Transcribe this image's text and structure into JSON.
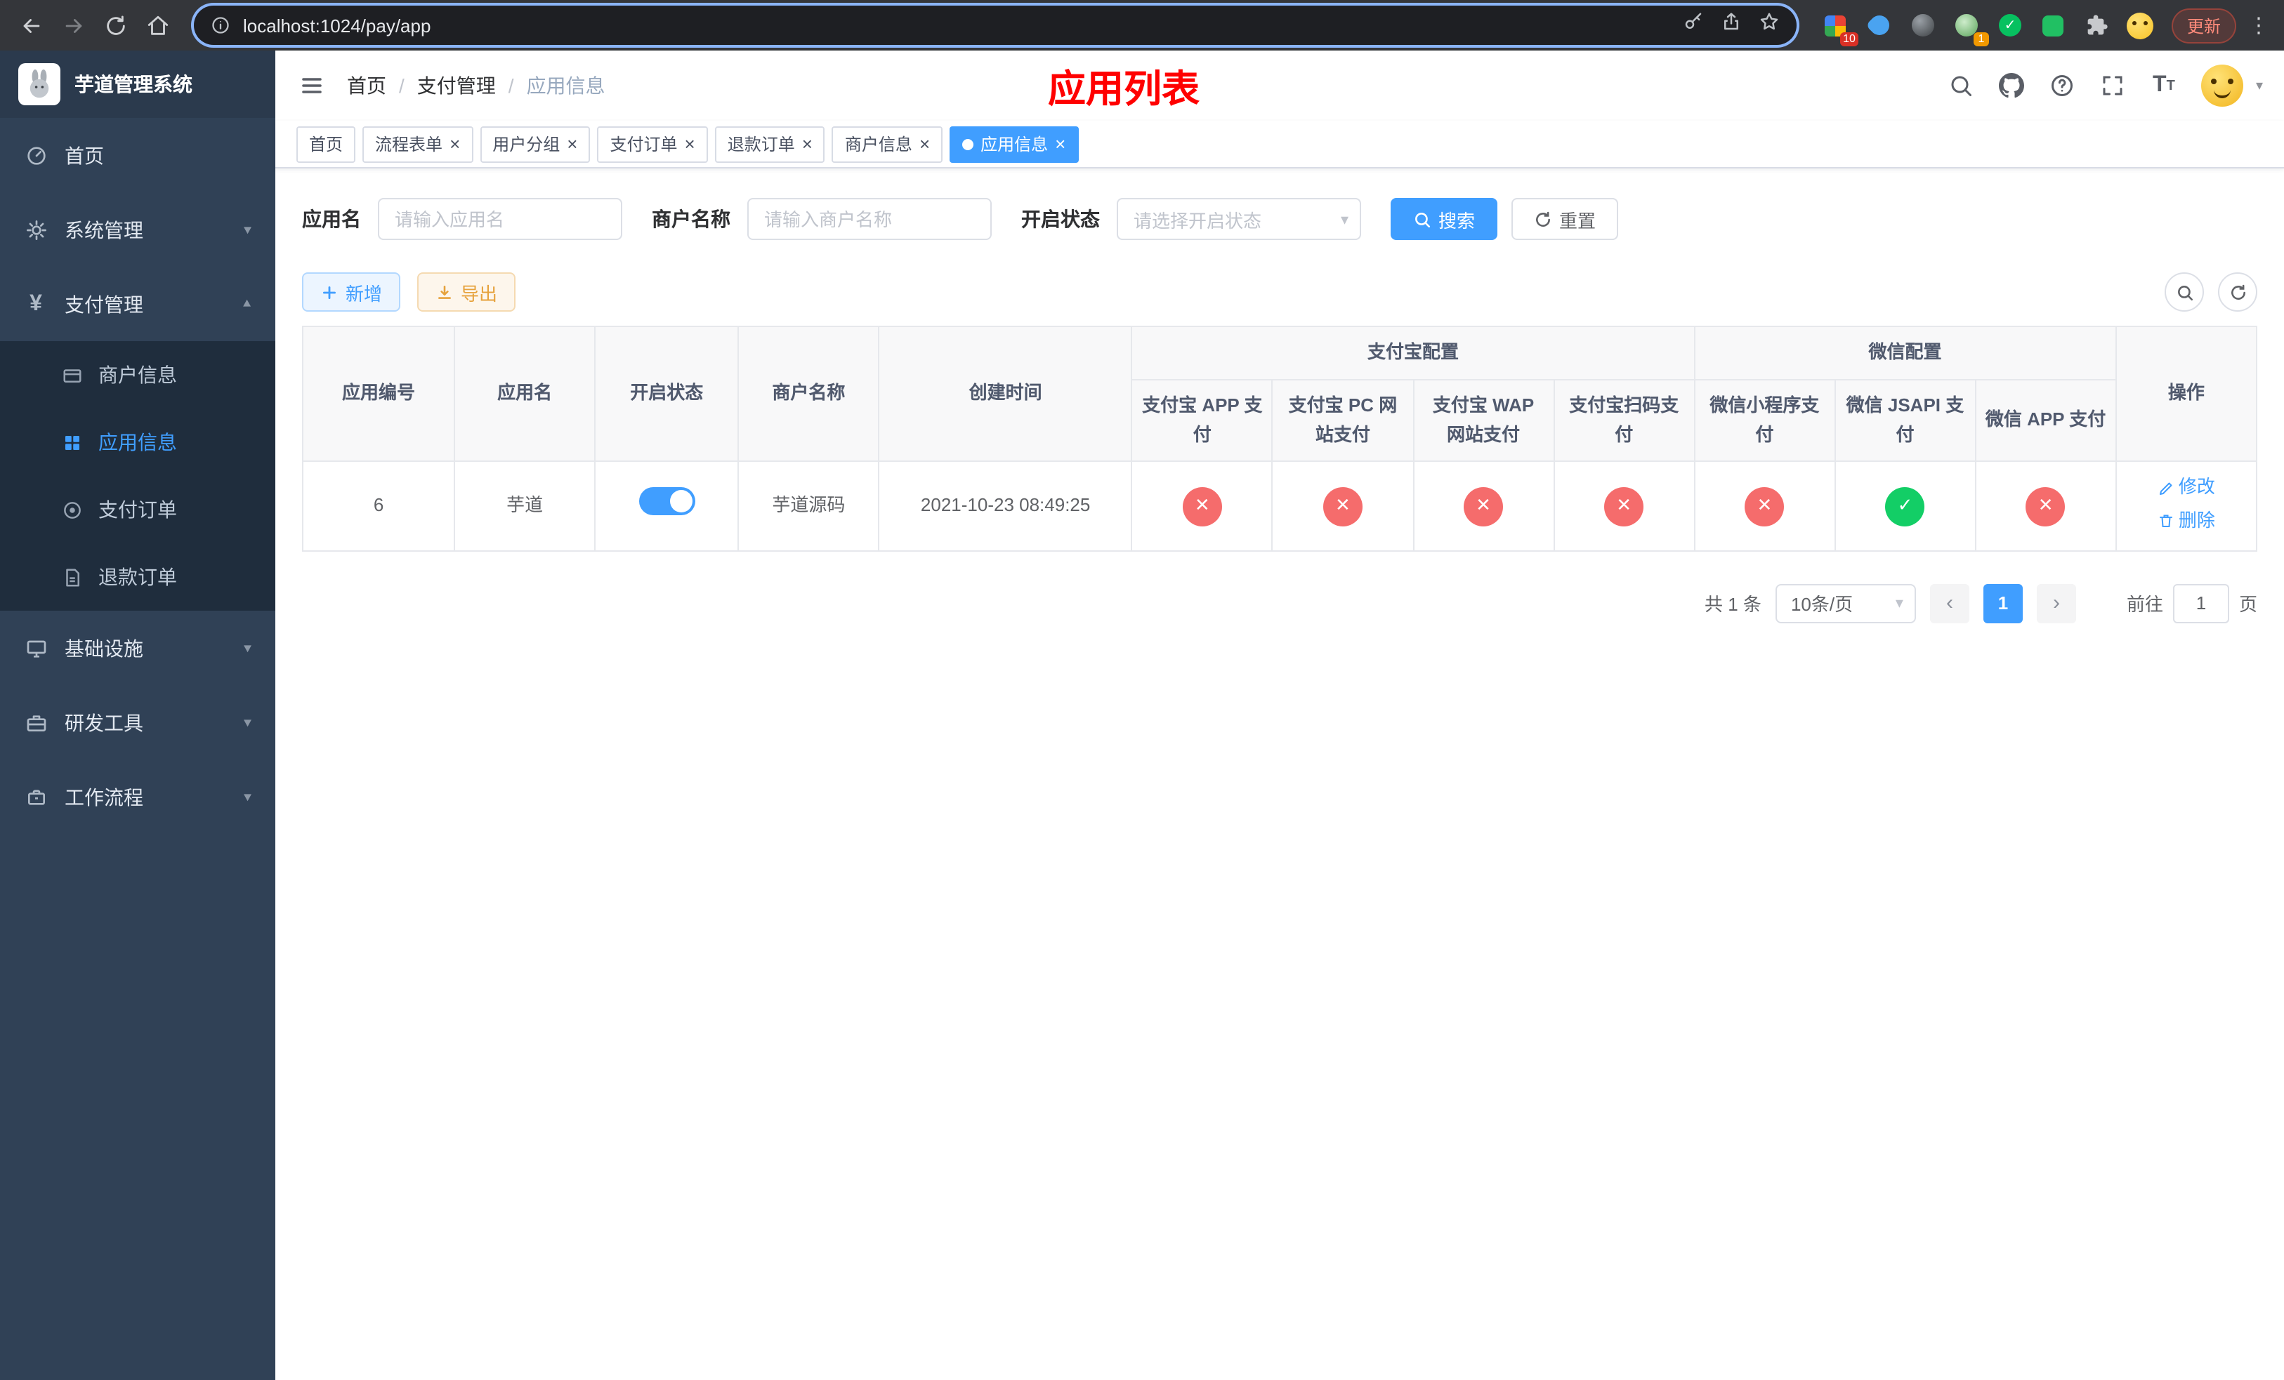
{
  "browser": {
    "url": "localhost:1024/pay/app",
    "update_label": "更新",
    "badges": {
      "grid": "10",
      "avatar": "1"
    }
  },
  "icons": {
    "close": "×",
    "caret_down": "▾",
    "prev": "‹",
    "next": "›",
    "check": "✓",
    "cross": "✕",
    "yen": "¥",
    "kebab": "⋮",
    "breadcrumb_sep": "/",
    "font_size_large": "T",
    "font_size_small": "T"
  },
  "sidebar": {
    "app_title": "芋道管理系统",
    "items": [
      {
        "label": "首页"
      },
      {
        "label": "系统管理"
      },
      {
        "label": "支付管理"
      },
      {
        "label": "基础设施"
      },
      {
        "label": "研发工具"
      },
      {
        "label": "工作流程"
      }
    ],
    "submenu": [
      {
        "label": "商户信息"
      },
      {
        "label": "应用信息"
      },
      {
        "label": "支付订单"
      },
      {
        "label": "退款订单"
      }
    ]
  },
  "header": {
    "breadcrumb": [
      {
        "label": "首页"
      },
      {
        "label": "支付管理"
      },
      {
        "label": "应用信息"
      }
    ],
    "page_title": "应用列表"
  },
  "tabs": [
    {
      "label": "首页"
    },
    {
      "label": "流程表单"
    },
    {
      "label": "用户分组"
    },
    {
      "label": "支付订单"
    },
    {
      "label": "退款订单"
    },
    {
      "label": "商户信息"
    },
    {
      "label": "应用信息"
    }
  ],
  "filters": {
    "app_name": {
      "label": "应用名",
      "placeholder": "请输入应用名"
    },
    "merchant": {
      "label": "商户名称",
      "placeholder": "请输入商户名称"
    },
    "status": {
      "label": "开启状态",
      "placeholder": "请选择开启状态"
    },
    "search_label": "搜索",
    "reset_label": "重置"
  },
  "toolbar": {
    "add_label": "新增",
    "export_label": "导出"
  },
  "table": {
    "groups": {
      "alipay": "支付宝配置",
      "wechat": "微信配置"
    },
    "columns": [
      "应用编号",
      "应用名",
      "开启状态",
      "商户名称",
      "创建时间",
      "支付宝 APP 支付",
      "支付宝 PC 网站支付",
      "支付宝 WAP 网站支付",
      "支付宝扫码支付",
      "微信小程序支付",
      "微信 JSAPI 支付",
      "微信 APP 支付",
      "操作"
    ],
    "row": {
      "id": "6",
      "name": "芋道",
      "enabled": true,
      "merchant": "芋道源码",
      "created_at": "2021-10-23 08:49:25",
      "alipay_app": false,
      "alipay_pc": false,
      "alipay_wap": false,
      "alipay_qr": false,
      "wechat_mini": false,
      "wechat_jsapi": true,
      "wechat_app": false,
      "edit_label": "修改",
      "delete_label": "删除"
    }
  },
  "pagination": {
    "total": "共 1 条",
    "page_size": "10条/页",
    "page": "1",
    "goto_prefix": "前往",
    "goto_value": "1",
    "goto_suffix": "页"
  },
  "colors": {
    "primary": "#409EFF",
    "success": "#13ce66",
    "danger": "#f56c6c",
    "warning": "#e6a23c",
    "title_red": "#ff0000",
    "sidebar_bg": "#304156",
    "submenu_bg": "#1f2d3d"
  }
}
